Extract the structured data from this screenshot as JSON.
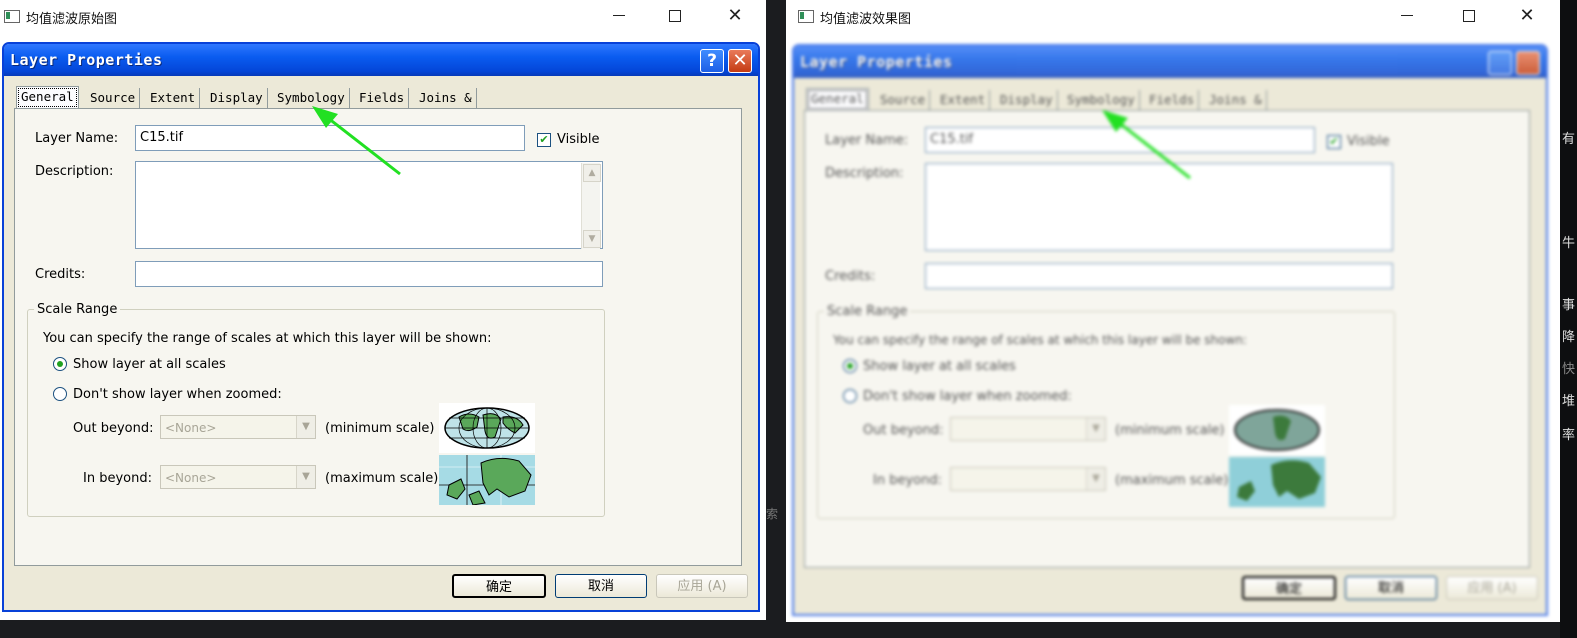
{
  "left_window": {
    "title": "均值滤波原始图",
    "controls": [
      "minimize-icon",
      "maximize-icon",
      "close-icon"
    ]
  },
  "right_window": {
    "title": "均值滤波效果图",
    "controls": [
      "minimize-icon",
      "maximize-icon",
      "close-icon"
    ]
  },
  "dialog": {
    "title": "Layer Properties",
    "help_label": "?",
    "close_label": "✕",
    "tabs": [
      "General",
      "Source",
      "Extent",
      "Display",
      "Symbology",
      "Fields",
      "Joins & Relates"
    ],
    "selected_tab": "General",
    "layer_name_label": "Layer Name:",
    "layer_name_value": "C15.tif",
    "visible_label": "Visible",
    "visible_checked": true,
    "description_label": "Description:",
    "description_value": "",
    "credits_label": "Credits:",
    "credits_value": "",
    "scale_range": {
      "title": "Scale Range",
      "intro": "You can specify the range of scales at which this layer will be shown:",
      "show_all_label": "Show layer at all scales",
      "dont_show_label": "Don't show layer when zoomed:",
      "selected": "Show layer at all scales",
      "out_beyond_label": "Out beyond:",
      "out_beyond_value": "<None>",
      "out_beyond_note": "(minimum scale)",
      "in_beyond_label": "In beyond:",
      "in_beyond_value": "<None>",
      "in_beyond_note": "(maximum scale)"
    },
    "ok_label": "确定",
    "cancel_label": "取消",
    "apply_label": "应用 (A)"
  },
  "annotation": {
    "arrow_color": "#22e022",
    "points_to": "Symbology"
  },
  "side_text": [
    "有",
    "牛",
    "事",
    "降",
    "快",
    "堆",
    "率",
    "索"
  ],
  "colors": {
    "xp_blue": "#0a5cf0",
    "dialog_bg": "#ece9d8",
    "panel_bg": "#f7f6f0"
  }
}
